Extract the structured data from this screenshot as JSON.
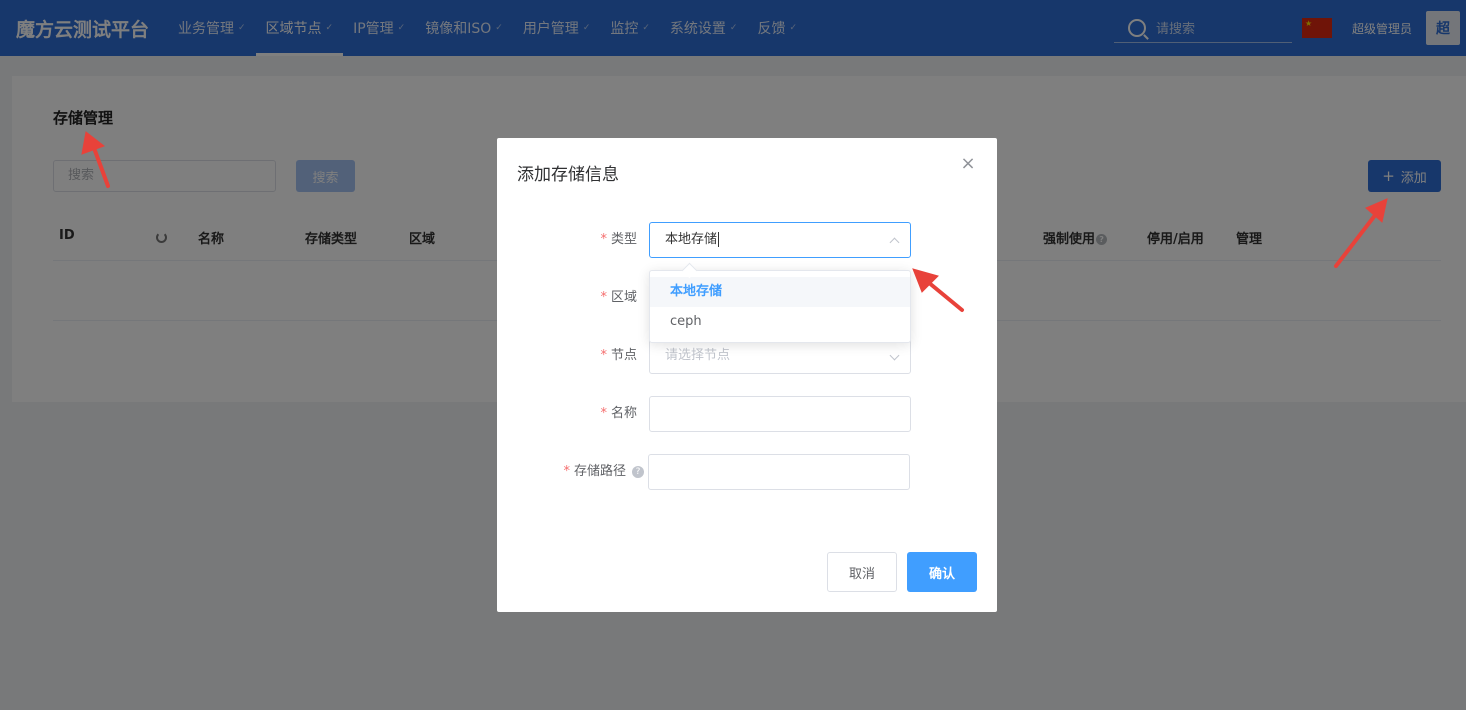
{
  "header": {
    "brand": "魔方云测试平台",
    "nav": [
      {
        "label": "业务管理"
      },
      {
        "label": "区域节点"
      },
      {
        "label": "IP管理"
      },
      {
        "label": "镜像和ISO"
      },
      {
        "label": "用户管理"
      },
      {
        "label": "监控"
      },
      {
        "label": "系统设置"
      },
      {
        "label": "反馈"
      }
    ],
    "active_nav": "区域节点",
    "search_placeholder": "请搜索",
    "user_name": "超级管理员",
    "avatar_text": "超",
    "brand_color": "#2f6fd6"
  },
  "page": {
    "title": "存储管理",
    "search_placeholder": "搜索",
    "search_button": "搜索",
    "add_button": "添加",
    "table_headers": [
      "ID",
      "名称",
      "存储类型",
      "区域",
      "强制使用",
      "停用/启用",
      "管理"
    ]
  },
  "dialog": {
    "title": "添加存储信息",
    "fields": {
      "type": {
        "label": "类型",
        "value": "本地存储"
      },
      "region": {
        "label": "区域"
      },
      "node": {
        "label": "节点",
        "placeholder": "请选择节点"
      },
      "name": {
        "label": "名称"
      },
      "path": {
        "label": "存储路径"
      }
    },
    "type_options": [
      "本地存储",
      "ceph"
    ],
    "selected_option": "本地存储",
    "cancel_button": "取消",
    "confirm_button": "确认",
    "accent_color": "#409eff"
  },
  "annotation_color": "#e8423a"
}
